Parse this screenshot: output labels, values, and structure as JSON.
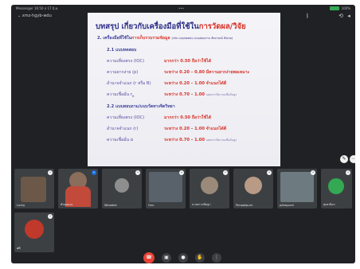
{
  "status_bar": {
    "left": "Messenger 16:50 ส 17 มิ.ย.",
    "center": "•••",
    "right": "100%"
  },
  "meeting": {
    "code": "xmz-hgyb-wdu"
  },
  "slide": {
    "title_prefix": "บทสรุป เกี่ยวกับเครื่องมือที่ใช้ใน",
    "title_accent": "การวัดผล/วิจัย",
    "heading_prefix": "2. เครื่องมือที่ใช้ใน",
    "heading_accent": "การเก็บรวบรวมข้อมูล",
    "heading_suffix": "(เช่น แบบทดสอบ แบบสอบถาม สัมภาษณ์ สังเกต)",
    "sub1": "2.1 แบบทดสอบ",
    "r1_label": "ความเที่ยงตรง (IOC)",
    "r1_value": "มากกว่า 0.50 ถือว่าใช้ได้",
    "r2_label": "ความยากง่าย (p)",
    "r2_value": "ระหว่าง 0.20 – 0.80 มีความยากง่ายพอเหมาะ",
    "r3_label": "อำนาจจำแนก (r หรือ B)",
    "r3_value": "ระหว่าง 0.20 – 1.00 จำแนกได้ดี",
    "r4_label": "ความเชื่อมั่น r",
    "r4_sub": "tt",
    "r4_value": "ระหว่าง 0.70 – 1.00",
    "r4_note": "แสดงว่ามีความเชื่อมั่นสูง",
    "sub2": "2.2 แบบสอบถาม/แบบวัดทางจิตวิทยา",
    "r5_label": "ความเที่ยงตรง (IOC)",
    "r5_value": "มากกว่า 0.50 ถือว่าใช้ได้",
    "r6_label": "อำนาจจำแนก (r)",
    "r6_value": "ระหว่าง 0.20 – 1.00 จำแนกได้ดี",
    "r7_label": "ความเชื่อมั่น α",
    "r7_value": "ระหว่าง 0.70 – 1.00",
    "r7_note": "แสดงว่ามีความเชื่อมั่นสูง"
  },
  "participants": [
    {
      "name": "Lucky",
      "color": "#6b5848"
    },
    {
      "name": "ตัวคุณเอง",
      "color": "#4a4040"
    },
    {
      "name": "Winadee",
      "color": "#2f3336"
    },
    {
      "name": "Onn",
      "color": "#59616a"
    },
    {
      "name": "นางสาวกนิษฐา",
      "color": "#3c4043"
    },
    {
      "name": "Pimpakpurn",
      "color": "#3c4043"
    },
    {
      "name": "pAkayumi",
      "color": "#6d7a7f"
    },
    {
      "name": "ทุเทวนิดา",
      "color": "#3c4043"
    },
    {
      "name": "ศศิ",
      "color": "#3c4043"
    }
  ],
  "icons": {
    "end_call": "end-call-icon",
    "camera": "camera-icon",
    "mic": "mic-icon",
    "hand": "raise-hand-icon",
    "more": "more-icon"
  }
}
